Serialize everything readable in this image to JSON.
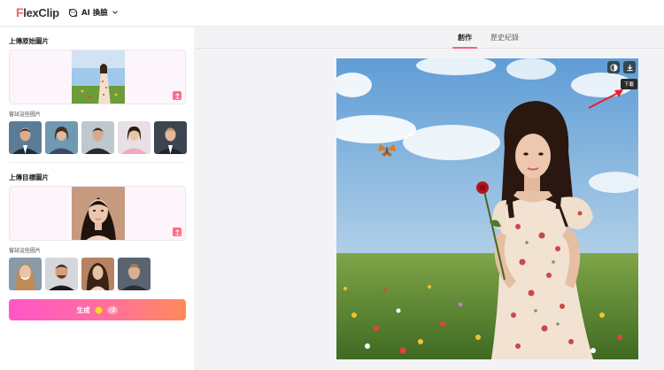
{
  "header": {
    "logo_prefix": "F",
    "logo_rest": "lexClip",
    "tool_name": "AI 換臉"
  },
  "left": {
    "source_title": "上傳原始圖片",
    "source_try_label": "嘗試這些圖片",
    "target_title": "上傳目標圖片",
    "target_try_label": "嘗試這些圖片",
    "generate_label": "生成",
    "generate_cost": "-2"
  },
  "right": {
    "tabs": [
      {
        "label": "創作",
        "active": true
      },
      {
        "label": "歷史紀錄",
        "active": false
      }
    ],
    "download_tooltip": "下載"
  },
  "icons": {
    "tool": "face-swap-icon",
    "dropdown": "chevron-down-icon",
    "upload": "upload-icon",
    "compare": "compare-icon",
    "download": "download-icon"
  },
  "colors": {
    "brand": "#ff5b70",
    "accent": "#ff5b8a",
    "upload_bg": "#fdf5fc",
    "tooltip_bg": "#2b2b2b",
    "arrow": "#e8202a"
  }
}
